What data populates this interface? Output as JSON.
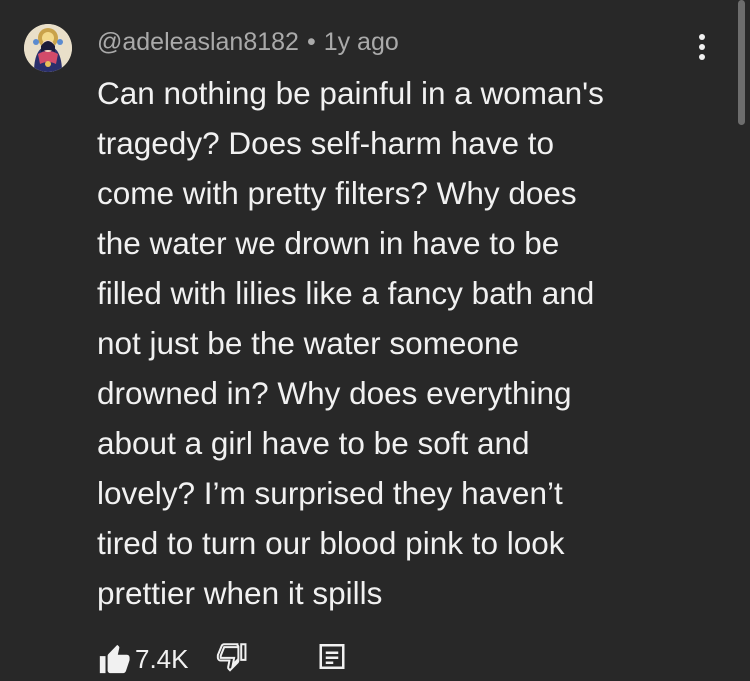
{
  "comment": {
    "author": "@adeleaslan8182",
    "separator": "•",
    "timestamp": "1y ago",
    "text_lines": [
      "Can nothing be painful in a woman's",
      "tragedy? Does self-harm have to",
      "come with pretty filters? Why does",
      "the water we drown in have to be",
      "filled with lilies like a fancy bath and",
      "not just be the water someone",
      "drowned in? Why does everything",
      "about a girl have to be soft and",
      "lovely? I’m surprised they haven’t",
      "tired to turn our blood pink to look",
      "prettier when it spills"
    ],
    "like_count": "7.4K"
  },
  "icons": {
    "avatar": "avatar-illustration",
    "more": "more-vert-icon",
    "like": "thumb-up-icon",
    "dislike": "thumb-down-icon",
    "reply": "reply-comment-icon"
  },
  "colors": {
    "background": "#282828",
    "text": "#f1f1f1",
    "meta": "#aaaaaa",
    "scrollbar": "#6d6d6d"
  }
}
